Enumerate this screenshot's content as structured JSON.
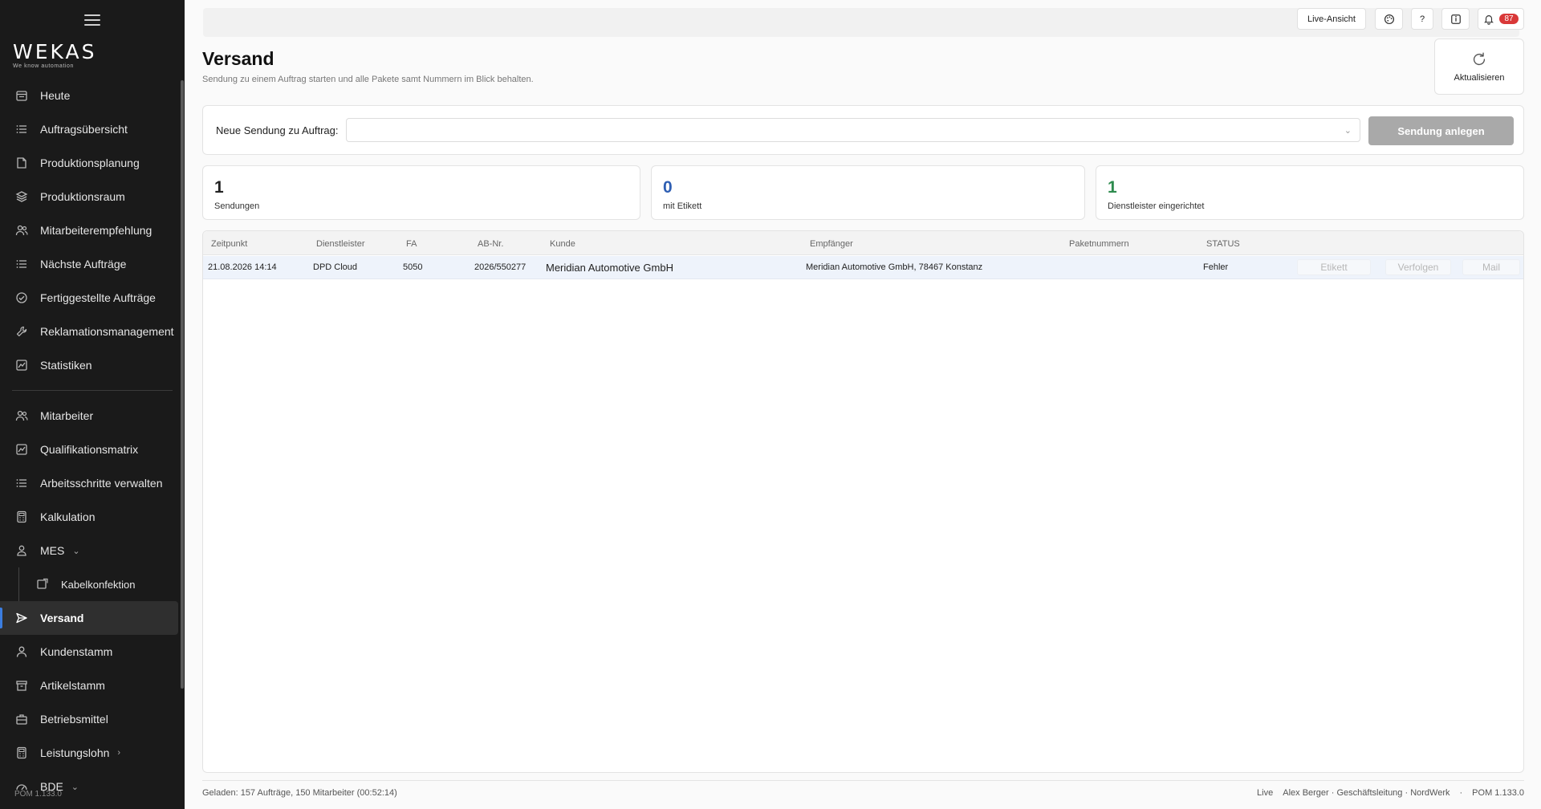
{
  "brand": {
    "name": "WEKAS",
    "tagline": "We know automation"
  },
  "sidebar": {
    "items_top": [
      {
        "label": "Heute",
        "icon": "calendar-icon"
      },
      {
        "label": "Auftragsübersicht",
        "icon": "list-icon"
      },
      {
        "label": "Produktionsplanung",
        "icon": "document-icon"
      },
      {
        "label": "Produktionsraum",
        "icon": "layers-icon"
      },
      {
        "label": "Mitarbeiterempfehlung",
        "icon": "users-icon"
      },
      {
        "label": "Nächste Aufträge",
        "icon": "list-icon"
      },
      {
        "label": "Fertiggestellte Aufträge",
        "icon": "check-circle-icon"
      },
      {
        "label": "Reklamationsmanagement",
        "icon": "wrench-icon"
      },
      {
        "label": "Statistiken",
        "icon": "chart-icon"
      }
    ],
    "items_bottom": [
      {
        "label": "Mitarbeiter",
        "icon": "users-icon"
      },
      {
        "label": "Qualifikationsmatrix",
        "icon": "chart-icon"
      },
      {
        "label": "Arbeitsschritte verwalten",
        "icon": "list-icon"
      },
      {
        "label": "Kalkulation",
        "icon": "calculator-icon"
      },
      {
        "label": "MES",
        "icon": "user-group-icon",
        "chevron": "⌄"
      },
      {
        "label": "Kabelkonfektion",
        "icon": "window-icon",
        "sub": true
      },
      {
        "label": "Versand",
        "icon": "send-icon",
        "active": true
      },
      {
        "label": "Kundenstamm",
        "icon": "user-icon"
      },
      {
        "label": "Artikelstamm",
        "icon": "box-icon"
      },
      {
        "label": "Betriebsmittel",
        "icon": "toolbox-icon"
      },
      {
        "label": "Leistungslohn",
        "icon": "calculator-icon",
        "chevron": "›"
      },
      {
        "label": "BDE",
        "icon": "gauge-icon",
        "chevron": "⌄"
      }
    ],
    "version": "POM 1.133.0"
  },
  "topbar": {
    "live_view_label": "Live-Ansicht",
    "help_label": "?",
    "notification_count": "87"
  },
  "page": {
    "title": "Versand",
    "subtitle": "Sendung zu einem Auftrag starten und alle Pakete samt Nummern im Blick behalten.",
    "refresh_label": "Aktualisieren"
  },
  "new_shipment": {
    "label": "Neue Sendung zu Auftrag:",
    "select_value": "",
    "button_label": "Sendung anlegen"
  },
  "stats": [
    {
      "value": "1",
      "label": "Sendungen",
      "color": "#222222"
    },
    {
      "value": "0",
      "label": "mit Etikett",
      "color": "#2f5fb3"
    },
    {
      "value": "1",
      "label": "Dienstleister eingerichtet",
      "color": "#2e8b4e"
    }
  ],
  "table": {
    "columns": [
      "Zeitpunkt",
      "Dienstleister",
      "FA",
      "AB-Nr.",
      "Kunde",
      "Empfänger",
      "Paketnummern",
      "STATUS"
    ],
    "rows": [
      {
        "zeitpunkt": "21.08.2026 14:14",
        "dienstleister": "DPD Cloud",
        "fa": "5050",
        "ab_nr": "2026/550277",
        "kunde": "Meridian Automotive GmbH",
        "empfaenger": "Meridian Automotive GmbH, 78467 Konstanz",
        "paketnummern": "",
        "status": "Fehler",
        "actions": [
          "Etikett",
          "Verfolgen",
          "Mail"
        ]
      }
    ]
  },
  "footer": {
    "loaded": "Geladen: 157 Aufträge, 150 Mitarbeiter (00:52:14)",
    "mode": "Live",
    "user": "Alex Berger · Geschäftsleitung · NordWerk",
    "separator": "·",
    "version": "POM 1.133.0"
  }
}
